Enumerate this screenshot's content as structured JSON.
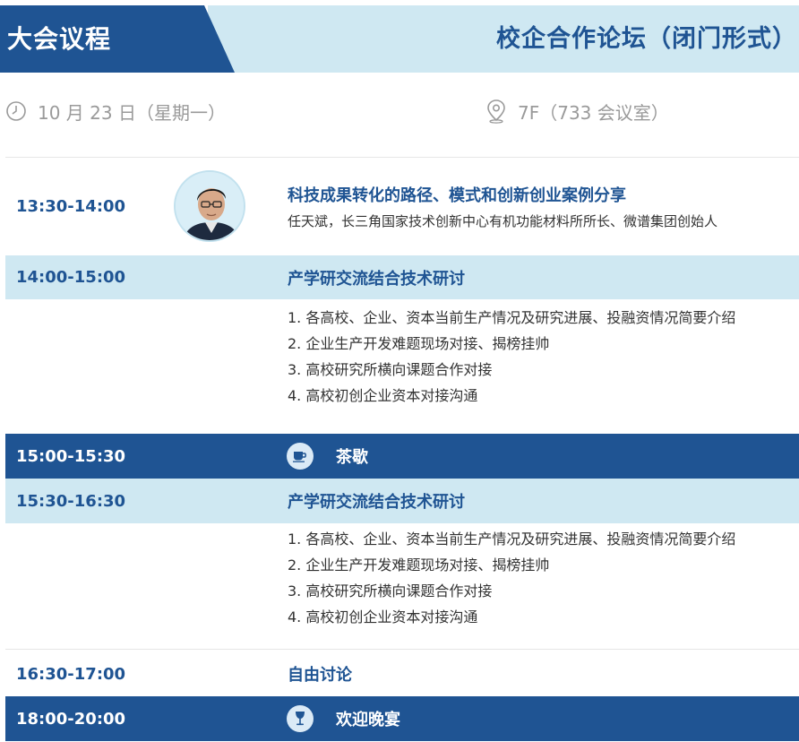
{
  "header": {
    "title": "大会议程",
    "forum": "校企合作论坛（闭门形式）"
  },
  "info": {
    "date": "10 月 23 日（星期一）",
    "location": "7F（733 会议室）",
    "date_icon": "clock-icon",
    "location_icon": "location-pin-icon"
  },
  "speaker": {
    "time": "13:30-14:00",
    "title": "科技成果转化的路径、模式和创新创业案例分享",
    "description": "任天斌，长三角国家技术创新中心有机功能材料所所长、微谱集团创始人",
    "avatar": "speaker-photo"
  },
  "session1": {
    "time": "14:00-15:00",
    "title": "产学研交流结合技术研讨",
    "items": [
      "1. 各高校、企业、资本当前生产情况及研究进展、投融资情况简要介绍",
      "2. 企业生产开发难题现场对接、揭榜挂帅",
      "3. 高校研究所横向课题合作对接",
      "4. 高校初创企业资本对接沟通"
    ]
  },
  "break": {
    "time": "15:00-15:30",
    "title": "茶歇",
    "icon": "coffee-cup-icon"
  },
  "session2": {
    "time": "15:30-16:30",
    "title": "产学研交流结合技术研讨",
    "items": [
      "1. 各高校、企业、资本当前生产情况及研究进展、投融资情况简要介绍",
      "2. 企业生产开发难题现场对接、揭榜挂帅",
      "3. 高校研究所横向课题合作对接",
      "4. 高校初创企业资本对接沟通"
    ]
  },
  "discussion": {
    "time": "16:30-17:00",
    "title": "自由讨论"
  },
  "dinner": {
    "time": "18:00-20:00",
    "title": "欢迎晚宴",
    "icon": "wine-glass-icon"
  },
  "colors": {
    "primary": "#1f5493",
    "light": "#cfe8f2",
    "muted": "#9a9a9a"
  }
}
